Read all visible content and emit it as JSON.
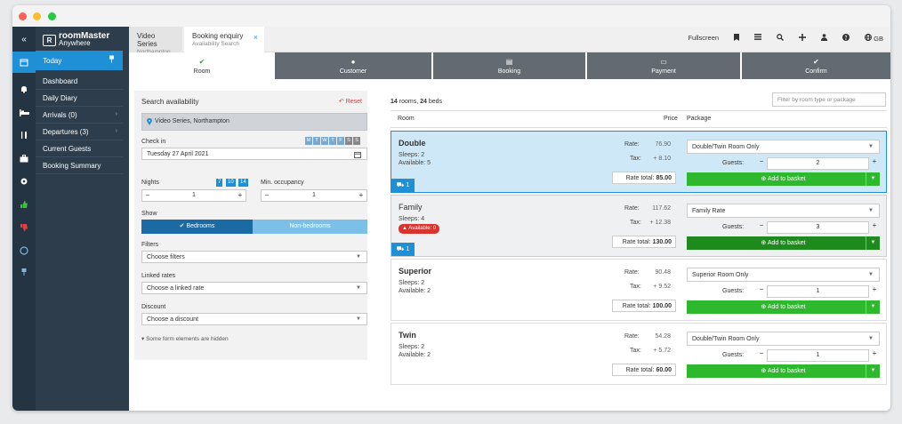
{
  "brand": {
    "line1": "roomMaster",
    "line2": "Anywhere",
    "logo_letter": "R"
  },
  "rail": {
    "collapse": "«"
  },
  "nav": {
    "today": "Today",
    "items": [
      {
        "label": "Dashboard",
        "chev": ""
      },
      {
        "label": "Daily Diary",
        "chev": ""
      },
      {
        "label": "Arrivals (0)",
        "chev": "›"
      },
      {
        "label": "Departures (3)",
        "chev": "›"
      },
      {
        "label": "Current Guests",
        "chev": ""
      },
      {
        "label": "Booking Summary",
        "chev": ""
      }
    ]
  },
  "tabs": [
    {
      "title": "Video Series",
      "sub": "Northampton"
    },
    {
      "title": "Booking enquiry",
      "sub": "Availability Search",
      "close": "×"
    }
  ],
  "topbar": {
    "fullscreen": "Fullscreen",
    "lang": "GB"
  },
  "steps": [
    {
      "label": "Room",
      "icon": "✔"
    },
    {
      "label": "Customer",
      "icon": "●"
    },
    {
      "label": "Booking",
      "icon": "▤"
    },
    {
      "label": "Payment",
      "icon": "▭"
    },
    {
      "label": "Confirm",
      "icon": "✔"
    }
  ],
  "search": {
    "title": "Search availability",
    "reset": "Reset",
    "location": "Video Series, Northampton",
    "checkin_label": "Check in",
    "checkin_value": "Tuesday 27 April 2021",
    "weekdays": [
      "M",
      "T",
      "W",
      "T",
      "F",
      "S",
      "S"
    ],
    "nights_label": "Nights",
    "nights_value": "1",
    "night_badges": [
      "7",
      "10",
      "14"
    ],
    "minocc_label": "Min. occupancy",
    "minocc_value": "1",
    "show_label": "Show",
    "bedrooms": "Bedrooms",
    "nonbedrooms": "Non-bedrooms",
    "filters_label": "Filters",
    "filters_value": "Choose filters",
    "linked_label": "Linked rates",
    "linked_value": "Choose a linked rate",
    "discount_label": "Discount",
    "discount_value": "Choose a discount",
    "hidden_note": "Some form elements are hidden"
  },
  "results": {
    "count_rooms": "14",
    "rooms_word": "rooms,",
    "count_beds": "24",
    "beds_word": "beds",
    "filter_placeholder": "Filter by room type or package",
    "col_room": "Room",
    "col_price": "Price",
    "col_package": "Package",
    "rate_label": "Rate:",
    "tax_label": "Tax:",
    "total_label": "Rate total:",
    "guests_label": "Guests:",
    "add_label": "Add to basket",
    "rooms": [
      {
        "name": "Double",
        "sleeps": "Sleeps: 2",
        "available": "Available: 5",
        "rate": "76.90",
        "tax": "+ 8.10",
        "total": "85.00",
        "package": "Double/Twin Room Only",
        "guests": "2",
        "cart": "1"
      },
      {
        "name": "Family",
        "sleeps": "Sleeps: 4",
        "available": "Available: 0",
        "rate": "117.62",
        "tax": "+ 12.38",
        "total": "130.00",
        "package": "Family Rate",
        "guests": "3",
        "cart": "1"
      },
      {
        "name": "Superior",
        "sleeps": "Sleeps: 2",
        "available": "Available: 2",
        "rate": "90.48",
        "tax": "+ 9.52",
        "total": "100.00",
        "package": "Superior Room Only",
        "guests": "1",
        "cart": ""
      },
      {
        "name": "Twin",
        "sleeps": "Sleeps: 2",
        "available": "Available: 2",
        "rate": "54.28",
        "tax": "+ 5.72",
        "total": "60.00",
        "package": "Double/Twin Room Only",
        "guests": "1",
        "cart": ""
      }
    ]
  },
  "colors": {
    "accent": "#1f90d5",
    "nav_bg": "#2d3d4c",
    "rail_bg": "#243443",
    "green": "#2eb82e",
    "danger": "#d9332e",
    "step_grey": "#636a71"
  }
}
